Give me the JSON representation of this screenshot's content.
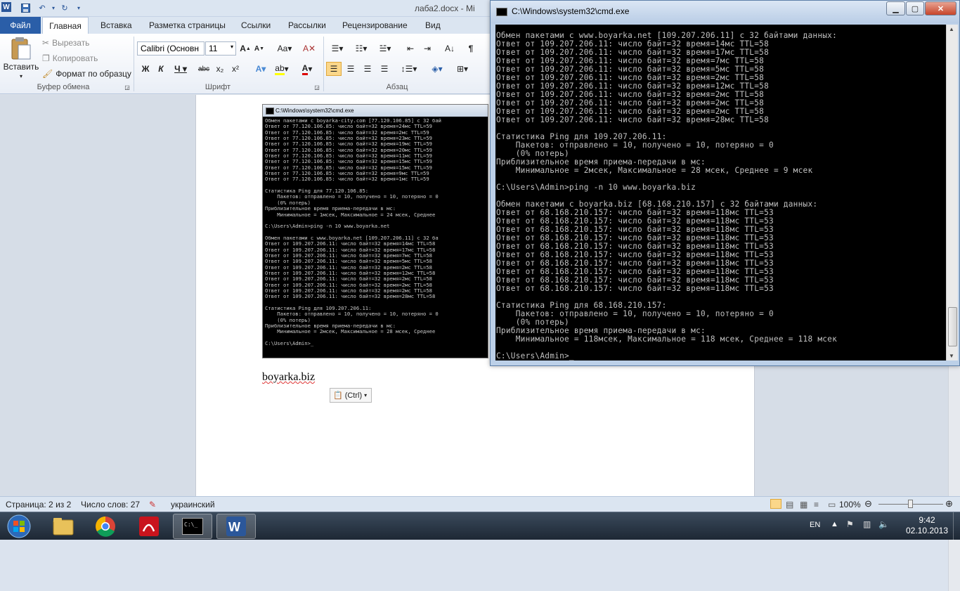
{
  "word": {
    "doc_title": "лаба2.docx - Mi",
    "tabs": [
      "Файл",
      "Главная",
      "Вставка",
      "Разметка страницы",
      "Ссылки",
      "Рассылки",
      "Рецензирование",
      "Вид"
    ],
    "clipboard": {
      "paste_label": "Вставить",
      "cut_label": "Вырезать",
      "copy_label": "Копировать",
      "format_painter_label": "Формат по образцу",
      "group_label": "Буфер обмена"
    },
    "font": {
      "font_name": "Calibri (Основн",
      "font_size": "11",
      "group_label": "Шрифт"
    },
    "paragraph": {
      "group_label": "Абзац"
    },
    "document": {
      "text": "boyarka.biz",
      "paste_options_label": "(Ctrl)"
    },
    "embedded_cmd": {
      "title": "C:\\Windows\\system32\\cmd.exe",
      "lines": [
        "Обмен пакетами с boyarka-city.com [77.120.106.85] с 32 бай",
        "Ответ от 77.120.106.85: число байт=32 время=24мс TTL=59",
        "Ответ от 77.120.106.85: число байт=32 время=2мс TTL=59",
        "Ответ от 77.120.106.85: число байт=32 время=23мс TTL=59",
        "Ответ от 77.120.106.85: число байт=32 время=19мс TTL=59",
        "Ответ от 77.120.106.85: число байт=32 время=20мс TTL=59",
        "Ответ от 77.120.106.85: число байт=32 время=11мс TTL=59",
        "Ответ от 77.120.106.85: число байт=32 время=15мс TTL=59",
        "Ответ от 77.120.106.85: число байт=32 время=15мс TTL=59",
        "Ответ от 77.120.106.85: число байт=32 время=9мс TTL=59",
        "Ответ от 77.120.106.85: число байт=32 время=1мс TTL=59",
        "",
        "Статистика Ping для 77.120.106.85:",
        "    Пакетов: отправлено = 10, получено = 10, потеряно = 0",
        "    (0% потерь)",
        "Приблизительное время приема-передачи в мс:",
        "    Минимальное = 1мсек, Максимальное = 24 мсек, Среднее",
        "",
        "C:\\Users\\Admin>ping -n 10 www.boyarka.net",
        "",
        "Обмен пакетами с www.boyarka.net [109.207.206.11] с 32 ба",
        "Ответ от 109.207.206.11: число байт=32 время=14мс TTL=58",
        "Ответ от 109.207.206.11: число байт=32 время=17мс TTL=58",
        "Ответ от 109.207.206.11: число байт=32 время=7мс TTL=58",
        "Ответ от 109.207.206.11: число байт=32 время=5мс TTL=58",
        "Ответ от 109.207.206.11: число байт=32 время=2мс TTL=58",
        "Ответ от 109.207.206.11: число байт=32 время=12мс TTL=58",
        "Ответ от 109.207.206.11: число байт=32 время=2мс TTL=58",
        "Ответ от 109.207.206.11: число байт=32 время=2мс TTL=58",
        "Ответ от 109.207.206.11: число байт=32 время=2мс TTL=58",
        "Ответ от 109.207.206.11: число байт=32 время=28мс TTL=58",
        "",
        "Статистика Ping для 109.207.206.11:",
        "    Пакетов: отправлено = 10, получено = 10, потеряно = 0",
        "    (0% потерь)",
        "Приблизительное время приема-передачи в мс:",
        "    Минимальное = 2мсек, Максимальное = 28 мсек, Среднее",
        "",
        "C:\\Users\\Admin>_"
      ]
    },
    "status": {
      "page": "Страница: 2 из 2",
      "words": "Число слов: 27",
      "language": "украинский",
      "zoom": "100%"
    }
  },
  "cmd_window": {
    "title": "C:\\Windows\\system32\\cmd.exe",
    "lines": [
      "Обмен пакетами с www.boyarka.net [109.207.206.11] с 32 байтами данных:",
      "Ответ от 109.207.206.11: число байт=32 время=14мс TTL=58",
      "Ответ от 109.207.206.11: число байт=32 время=17мс TTL=58",
      "Ответ от 109.207.206.11: число байт=32 время=7мс TTL=58",
      "Ответ от 109.207.206.11: число байт=32 время=5мс TTL=58",
      "Ответ от 109.207.206.11: число байт=32 время=2мс TTL=58",
      "Ответ от 109.207.206.11: число байт=32 время=12мс TTL=58",
      "Ответ от 109.207.206.11: число байт=32 время=2мс TTL=58",
      "Ответ от 109.207.206.11: число байт=32 время=2мс TTL=58",
      "Ответ от 109.207.206.11: число байт=32 время=2мс TTL=58",
      "Ответ от 109.207.206.11: число байт=32 время=28мс TTL=58",
      "",
      "Статистика Ping для 109.207.206.11:",
      "    Пакетов: отправлено = 10, получено = 10, потеряно = 0",
      "    (0% потерь)",
      "Приблизительное время приема-передачи в мс:",
      "    Минимальное = 2мсек, Максимальное = 28 мсек, Среднее = 9 мсек",
      "",
      "C:\\Users\\Admin>ping -n 10 www.boyarka.biz",
      "",
      "Обмен пакетами с boyarka.biz [68.168.210.157] с 32 байтами данных:",
      "Ответ от 68.168.210.157: число байт=32 время=118мс TTL=53",
      "Ответ от 68.168.210.157: число байт=32 время=118мс TTL=53",
      "Ответ от 68.168.210.157: число байт=32 время=118мс TTL=53",
      "Ответ от 68.168.210.157: число байт=32 время=118мс TTL=53",
      "Ответ от 68.168.210.157: число байт=32 время=118мс TTL=53",
      "Ответ от 68.168.210.157: число байт=32 время=118мс TTL=53",
      "Ответ от 68.168.210.157: число байт=32 время=118мс TTL=53",
      "Ответ от 68.168.210.157: число байт=32 время=118мс TTL=53",
      "Ответ от 68.168.210.157: число байт=32 время=118мс TTL=53",
      "Ответ от 68.168.210.157: число байт=32 время=118мс TTL=53",
      "",
      "Статистика Ping для 68.168.210.157:",
      "    Пакетов: отправлено = 10, получено = 10, потеряно = 0",
      "    (0% потерь)",
      "Приблизительное время приема-передачи в мс:",
      "    Минимальное = 118мсек, Максимальное = 118 мсек, Среднее = 118 мсек",
      "",
      "C:\\Users\\Admin>_"
    ]
  },
  "taskbar": {
    "language": "EN",
    "time": "9:42",
    "date": "02.10.2013"
  },
  "colors": {
    "word_accent": "#2a5ea8",
    "cmd_background": "#000000",
    "cmd_text": "#c0c0c0"
  }
}
